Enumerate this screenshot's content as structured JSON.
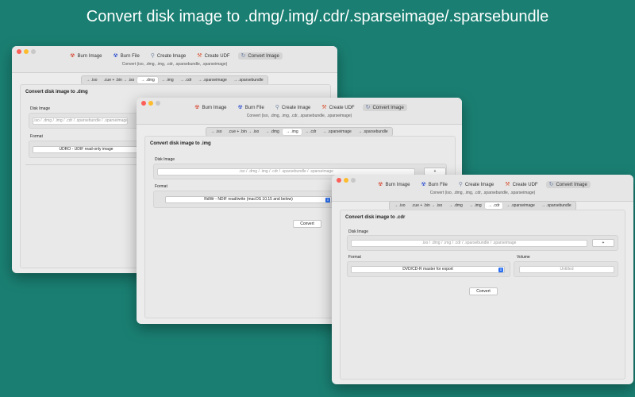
{
  "headline": "Convert disk image to .dmg/.img/.cdr/.sparseimage/.sparsebundle",
  "toolbar": {
    "burn_image": "Burn Image",
    "burn_file": "Burn File",
    "create_image": "Create Image",
    "create_udf": "Create UDF",
    "convert_image": "Convert Image"
  },
  "subtitle": "Convert (iso, .dmg, .img, .cdr, .sparsebundle, .sparseimage)",
  "tabs": [
    "→ .iso",
    ".cue + .bin → .iso",
    "→ .dmg",
    "→ .img",
    "→ .cdr",
    "→ .sparseimage",
    "→ .sparsebundle"
  ],
  "labels": {
    "disk_image": "Disk Image",
    "format": "Format",
    "volume": "Volume",
    "plus": "+",
    "convert": "Convert"
  },
  "placeholder": ".iso / .dmg / .img / .cdr / .sparsebundle / .sparseimage",
  "win1": {
    "title": "Convert disk image to .dmg",
    "format_value": "UDRO - UDIF read-only image"
  },
  "win2": {
    "title": "Convert disk image to .img",
    "format_value": "RdWr - NDIF read/write (macOS 10.15 and below)"
  },
  "win3": {
    "title": "Convert disk image to .cdr",
    "format_value": "DVD/CD-R master for export",
    "volume_placeholder": "Untitled"
  }
}
